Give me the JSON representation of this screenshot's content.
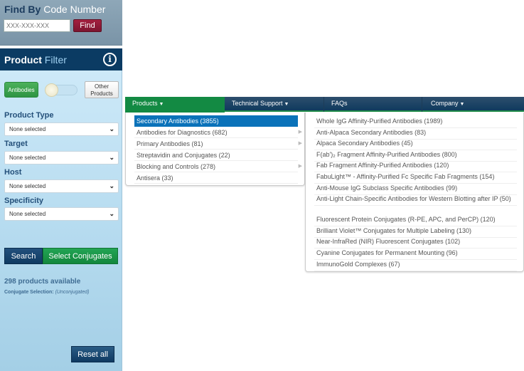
{
  "findby": {
    "title_bold": "Find By",
    "title_rest": "Code Number",
    "input_placeholder": "XXX-XXX-XXX",
    "find_label": "Find"
  },
  "filter": {
    "title_bold": "Product",
    "title_rest": "Filter",
    "info_icon": "i",
    "antibodies_label": "Antibodies",
    "other_line1": "Other",
    "other_line2": "Products",
    "toggle_state": "antibodies",
    "fields": [
      {
        "label": "Product Type",
        "value": "None selected"
      },
      {
        "label": "Target",
        "value": "None selected"
      },
      {
        "label": "Host",
        "value": "None selected"
      },
      {
        "label": "Specificity",
        "value": "None selected"
      }
    ],
    "chevron": "⌄",
    "search_label": "Search",
    "conjugates_label": "Select Conjugates",
    "available": "298 products available",
    "conj_sel_label": "Conjugate Selection:",
    "conj_sel_value": "(Unconjugated)",
    "reset_label": "Reset all"
  },
  "nav": {
    "items": [
      {
        "label": "Products",
        "caret": "▼"
      },
      {
        "label": "Technical Support",
        "caret": "▼"
      },
      {
        "label": "FAQs",
        "caret": ""
      },
      {
        "label": "Company",
        "caret": "▼"
      }
    ]
  },
  "menu_left": [
    {
      "label": "Secondary Antibodies (3855)",
      "active": true,
      "arrow": ""
    },
    {
      "label": "Antibodies for Diagnostics (682)",
      "arrow": "▶"
    },
    {
      "label": "Primary Antibodies (81)",
      "arrow": "▶"
    },
    {
      "label": "Streptavidin and Conjugates (22)",
      "arrow": ""
    },
    {
      "label": "Blocking and Controls (278)",
      "arrow": "▶"
    },
    {
      "label": "Antisera (33)",
      "arrow": ""
    }
  ],
  "menu_right": [
    "Whole IgG Affinity-Purified Antibodies (1989)",
    "Anti-Alpaca Secondary Antibodies (83)",
    "Alpaca Secondary Antibodies (45)",
    "F(ab')₂ Fragment Affinity-Purified Antibodies (800)",
    "Fab Fragment Affinity-Purified Antibodies (120)",
    "FabuLight™ - Affinity-Purified Fc Specific Fab Fragments (154)",
    "Anti-Mouse IgG Subclass Specific Antibodies (99)",
    "Anti-Light Chain-Specific Antibodies for Western Blotting after IP (50)",
    "Fluorescent Protein Conjugates (R-PE, APC, and PerCP) (120)",
    "Brilliant Violet™ Conjugates for Multiple Labeling (130)",
    "Near-InfraRed (NIR) Fluorescent Conjugates (102)",
    "Cyanine Conjugates for Permanent Mounting (96)",
    "ImmunoGold Complexes (67)"
  ]
}
